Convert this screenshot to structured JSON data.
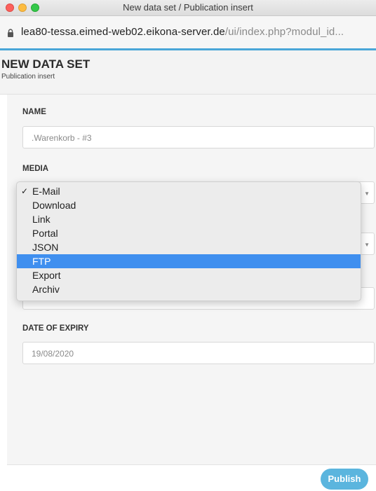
{
  "window": {
    "title": "New data set / Publication insert"
  },
  "browser": {
    "url_host": "lea80-tessa.eimed-web02.eikona-server.de",
    "url_path": "/ui/index.php?modul_id..."
  },
  "header": {
    "title": "NEW DATA SET",
    "subtitle": "Publication insert"
  },
  "form": {
    "name": {
      "label": "NAME",
      "value": ".Warenkorb - #3"
    },
    "media": {
      "label": "MEDIA",
      "options": [
        "E-Mail",
        "Download",
        "Link",
        "Portal",
        "JSON",
        "FTP",
        "Export",
        "Archiv"
      ],
      "checked": "E-Mail",
      "highlighted": "FTP"
    },
    "date_of_expiry": {
      "label": "DATE OF EXPIRY",
      "value": "19/08/2020"
    }
  },
  "footer": {
    "publish_label": "Publish"
  },
  "colors": {
    "accent": "#4aa6d8",
    "highlight": "#3f8fef",
    "publish_button": "#5bb5de"
  }
}
